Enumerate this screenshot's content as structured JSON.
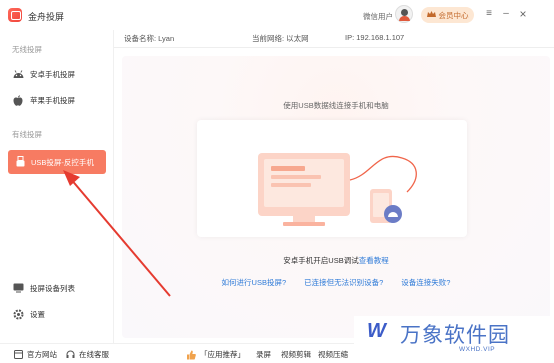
{
  "app": {
    "title": "金舟投屏"
  },
  "header": {
    "user_label": "微信用户",
    "vip_label": "会员中心"
  },
  "window_controls": {
    "menu": "≡",
    "minimize": "–",
    "close": "×"
  },
  "sidebar": {
    "section_wireless": "无线投屏",
    "android_wireless": "安卓手机投屏",
    "apple_wireless": "苹果手机投屏",
    "section_wired": "有线投屏",
    "usb_active": "USB投屏-反控手机",
    "device_list": "投屏设备列表",
    "settings": "设置"
  },
  "info": {
    "device_name": "设备名称: Lyan",
    "network": "当前网络:  以太网",
    "ip": "IP: 192.168.1.107"
  },
  "panel": {
    "title": "使用USB数据线连接手机和电脑",
    "tip_prefix": "安卓手机开启USB调试",
    "tip_link": "查看教程",
    "help_links": [
      "如何进行USB投屏?",
      "已连接但无法识别设备?",
      "设备连接失败?"
    ]
  },
  "bottombar": {
    "website": "官方网站",
    "support": "在线客服",
    "recommend": "「应用推荐」",
    "apps": [
      "录屏",
      "视频剪辑",
      "视频压缩"
    ]
  },
  "watermark": {
    "name": "万象软件园",
    "url": "WXHD.VIP"
  },
  "colors": {
    "accent": "#f77b62",
    "link": "#2f7bd8",
    "arrow": "#e53b30"
  },
  "icons": [
    "app-logo-icon",
    "android-icon",
    "apple-icon",
    "usb-icon",
    "device-list-icon",
    "settings-icon",
    "globe-icon",
    "headset-icon",
    "thumb-icon"
  ]
}
